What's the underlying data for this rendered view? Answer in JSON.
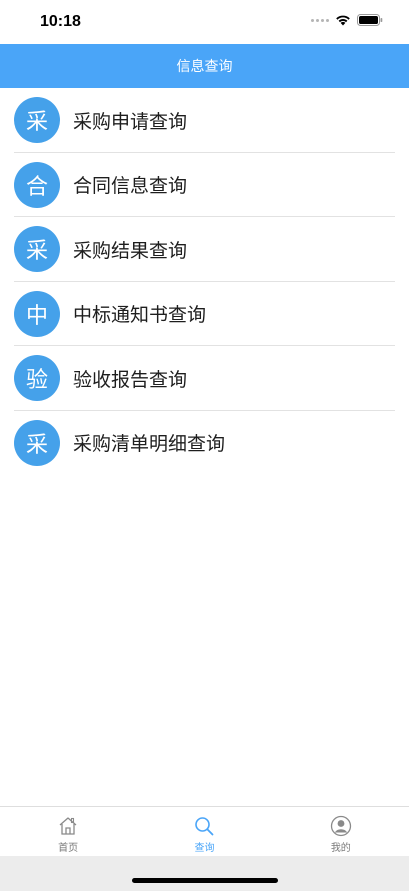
{
  "status_bar": {
    "time": "10:18"
  },
  "nav": {
    "title": "信息查询"
  },
  "list": {
    "items": [
      {
        "badge": "采",
        "label": "采购申请查询"
      },
      {
        "badge": "合",
        "label": "合同信息查询"
      },
      {
        "badge": "采",
        "label": "采购结果查询"
      },
      {
        "badge": "中",
        "label": "中标通知书查询"
      },
      {
        "badge": "验",
        "label": "验收报告查询"
      },
      {
        "badge": "采",
        "label": "采购清单明细查询"
      }
    ]
  },
  "tab_bar": {
    "tabs": [
      {
        "label": "首页",
        "icon": "home-icon"
      },
      {
        "label": "查询",
        "icon": "search-icon",
        "active": true
      },
      {
        "label": "我的",
        "icon": "profile-icon"
      }
    ]
  },
  "colors": {
    "accent": "#4aa5f8",
    "badge": "#45a1ea",
    "inactive_tab": "#7a7a7a"
  }
}
